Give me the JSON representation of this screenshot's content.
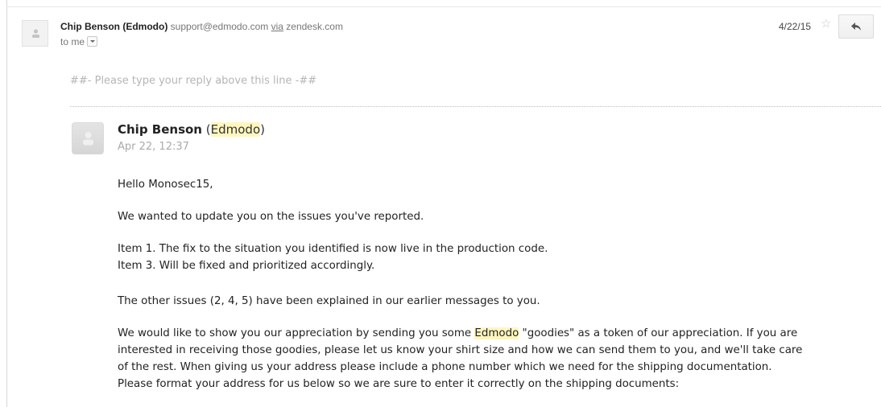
{
  "email": {
    "sender_name": "Chip Benson (Edmodo)",
    "sender_email": "support@edmodo.com",
    "via_label": "via",
    "via_domain": "zendesk.com",
    "to_label": "to me",
    "date": "4/22/15",
    "icons": {
      "star": "star-icon",
      "reply": "reply-arrow-icon",
      "dropdown": "chevron-down-icon",
      "avatar": "person-icon"
    }
  },
  "reply_marker": "##- Please type your reply above this line -##",
  "message": {
    "author_name": "Chip Benson",
    "author_org_open": "(",
    "author_org": "Edmodo",
    "author_org_close": ")",
    "timestamp": "Apr 22, 12:37",
    "greeting": "Hello Monosec15,",
    "para1": "We wanted to update you on the issues you've reported.",
    "item1": "Item 1. The fix to the situation you identified is now live in the production code.",
    "item3": "Item 3. Will be fixed and prioritized accordingly.",
    "para3": "The other issues (2, 4, 5) have been explained in our earlier messages to you.",
    "para4_before": "We would like to show you our appreciation by sending you some ",
    "para4_highlight": "Edmodo",
    "para4_after": " \"goodies\" as a token of our appreciation. If you are",
    "para4_line2": "interested in receiving those goodies, please let us know your shirt size and how we can send them to you, and we'll take care",
    "para4_line3": "of the rest. When giving us your address please include a phone number which we need for the shipping documentation.",
    "para4_line4": "Please format your address for us below so we are sure to enter it correctly on the shipping documents:"
  }
}
